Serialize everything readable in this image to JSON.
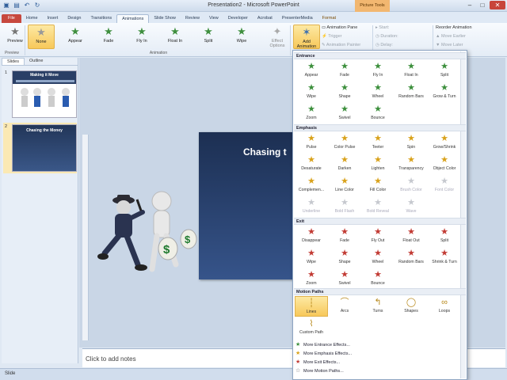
{
  "window": {
    "title": "Presentation2 - Microsoft PowerPoint",
    "context_group": "Picture Tools"
  },
  "tabs": [
    "File",
    "Home",
    "Insert",
    "Design",
    "Transitions",
    "Animations",
    "Slide Show",
    "Review",
    "View",
    "Developer",
    "Acrobat",
    "PresenterMedia",
    "Format"
  ],
  "ribbon": {
    "preview_label": "Preview",
    "preview_group": "Preview",
    "animation_group": "Animation",
    "animations": [
      "None",
      "Appear",
      "Fade",
      "Fly In",
      "Float In",
      "Split",
      "Wipe"
    ],
    "effect_options": "Effect Options",
    "add_animation": "Add Animation",
    "animation_pane": "Animation Pane",
    "trigger": "Trigger",
    "animation_painter": "Animation Painter",
    "start": "Start:",
    "duration": "Duration:",
    "delay": "Delay:",
    "reorder": "Reorder Animation",
    "move_earlier": "Move Earlier",
    "move_later": "Move Later"
  },
  "left_panel": {
    "tab_slides": "Slides",
    "tab_outline": "Outline",
    "slide1_num": "1",
    "slide1_title": "Making it Move",
    "slide2_num": "2",
    "slide2_title": "Chasing the Money"
  },
  "slide": {
    "title": "Chasing t"
  },
  "notes_placeholder": "Click to add notes",
  "status": "Slide",
  "gallery": {
    "entrance_header": "Entrance",
    "entrance": [
      "Appear",
      "Fade",
      "Fly In",
      "Float In",
      "Split",
      "Wipe",
      "Shape",
      "Wheel",
      "Random Bars",
      "Grow & Turn",
      "Zoom",
      "Swivel",
      "Bounce"
    ],
    "emphasis_header": "Emphasis",
    "emphasis": [
      "Pulse",
      "Color Pulse",
      "Teeter",
      "Spin",
      "Grow/Shrink",
      "Desaturate",
      "Darken",
      "Lighten",
      "Transparency",
      "Object Color",
      "Complemen...",
      "Line Color",
      "Fill Color",
      "Brush Color",
      "Font Color",
      "Underline",
      "Bold Flash",
      "Bold Reveal",
      "Wave"
    ],
    "emphasis_disabled": [
      13,
      14,
      15,
      16,
      17,
      18
    ],
    "exit_header": "Exit",
    "exit": [
      "Disappear",
      "Fade",
      "Fly Out",
      "Float Out",
      "Split",
      "Wipe",
      "Shape",
      "Wheel",
      "Random Bars",
      "Shrink & Turn",
      "Zoom",
      "Swivel",
      "Bounce"
    ],
    "paths_header": "Motion Paths",
    "paths": [
      "Lines",
      "Arcs",
      "Turns",
      "Shapes",
      "Loops",
      "Custom Path"
    ],
    "more": [
      "More Entrance Effects...",
      "More Emphasis Effects...",
      "More Exit Effects...",
      "More Motion Paths..."
    ]
  },
  "colors": {
    "accent": "#f7c85a",
    "file_tab": "#c7483e",
    "entrance": "#3c8f3c",
    "emphasis": "#d9a21b",
    "exit": "#c23b34"
  }
}
